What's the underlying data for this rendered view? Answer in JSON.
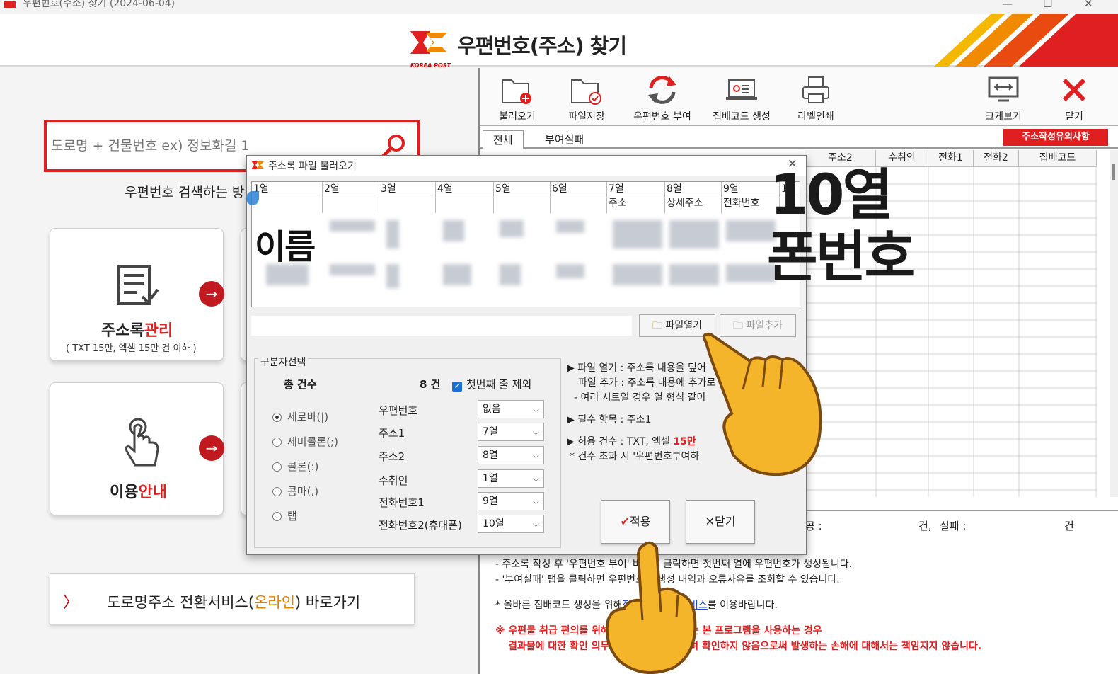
{
  "window": {
    "title": "우편번호(주소) 찾기 (2024-06-04)",
    "minimize": "—",
    "maximize": "☐",
    "close": "✕"
  },
  "header": {
    "logo_text": "KOREA POST",
    "title": "우편번호(주소) 찾기"
  },
  "search": {
    "placeholder": "도로명 + 건물번호 ex) 정보화길 1",
    "hint": "우편번호 검색하는 방"
  },
  "cards": [
    {
      "title_a": "주소록",
      "title_b": "관리",
      "sub": "( TXT 15만, 엑셀 15만 건 이하 )"
    },
    {
      "title_a": "이용",
      "title_b": "안내"
    }
  ],
  "road_service": {
    "label_a": "도로명주소 전환서비스(",
    "label_b": "온라인",
    "label_c": ") 바로가기"
  },
  "toolbar": [
    {
      "label": "불러오기"
    },
    {
      "label": "파일저장"
    },
    {
      "label": "우편번호 부여"
    },
    {
      "label": "집배코드 생성"
    },
    {
      "label": "라벨인쇄"
    },
    {
      "label": "크게보기"
    },
    {
      "label": "닫기"
    }
  ],
  "tabs": {
    "all": "전체",
    "fail": "부여실패",
    "notice": "주소작성유의사항"
  },
  "grid_headers": [
    "주소2",
    "수취인",
    "전화1",
    "전화2",
    "집배코드"
  ],
  "result": {
    "success_suffix": "공 :",
    "count_unit": "건,",
    "fail_label": "실패 :",
    "fail_unit": "건"
  },
  "info": {
    "line1": "- 주소록 작성 후 '우편번호 부여' 버튼을 클릭하면 첫번째 열에 우편번호가 생성됩니다.",
    "line2": "- '부여실패' 탭을 클릭하면 우편번호 미생성 내역과 오류사유를 조회할 수 있습니다.",
    "line3_a": "* 올바른 집배코드 생성을 위해",
    "line3_link": "집배코드 부여서비스",
    "line3_b": "를 이용바랍니다.",
    "warn1": "※ 우편물 취급 편의를 위해 참고자료로 제공하는 본 프로그램을 사용하는 경우",
    "warn2": "결과물에 대한 확인 의무는 사용자에게 있으며 확인하지 않음으로써 발생하는 손해에 대해서는 책임지지 않습니다."
  },
  "dialog": {
    "title": "주소록 파일 불러오기",
    "close": "✕",
    "columns": [
      "1열",
      "2열",
      "3열",
      "4열",
      "5열",
      "6열",
      "7열",
      "8열",
      "9열",
      "1"
    ],
    "row1_labels": {
      "c7": "주소",
      "c8": "상세주소",
      "c9": "전화번호"
    },
    "overlay_name": "이름",
    "open_file": "파일열기",
    "add_file": "파일추가",
    "separator_legend": "구분자선택",
    "total_label": "총 건수",
    "total_value": "8 건",
    "exclude_first": "첫번째 줄 제외",
    "separators": [
      "세로바(|)",
      "세미콜론(;)",
      "콜론(:)",
      "콤마(,)",
      "탭"
    ],
    "fields": [
      {
        "label": "우편번호",
        "value": "없음"
      },
      {
        "label": "주소1",
        "value": "7열"
      },
      {
        "label": "주소2",
        "value": "8열"
      },
      {
        "label": "수취인",
        "value": "1열"
      },
      {
        "label": "전화번호1",
        "value": "9열"
      },
      {
        "label": "전화번호2(휴대폰)",
        "value": "10열"
      }
    ],
    "help": {
      "l1": "파일 열기 : 주소록 내용을 덮어",
      "l2": "파일 추가 : 주소록 내용에 추가로",
      "l3": "- 여러 시트일 경우 열 형식 같이",
      "l4": "필수 항목 : 주소1",
      "l5_a": "허용 건수 : TXT, 엑셀 ",
      "l5_b": "15만",
      "l6": "* 건수 초과 시 '우편번호부여하"
    },
    "apply": "적용",
    "close_btn": "닫기"
  },
  "overlay": {
    "line1": "10열",
    "line2": "폰번호"
  },
  "colors": {
    "accent_red": "#e02020",
    "brand_red": "#c0191f",
    "link_blue": "#2244cc"
  }
}
